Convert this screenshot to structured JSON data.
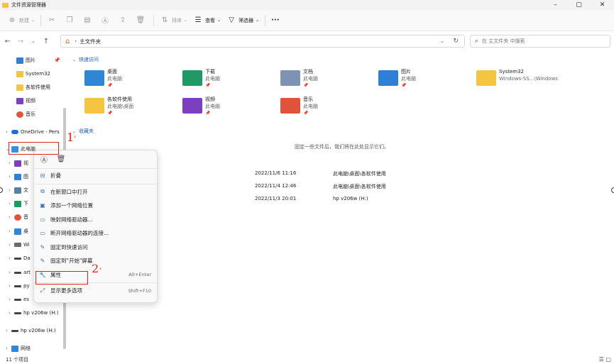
{
  "window": {
    "title": "文件资源管理器",
    "min": "–",
    "max": "▢",
    "close": "✕"
  },
  "toolbar": {
    "new_label": "新建",
    "sort_label": "排序",
    "view_label": "查看",
    "filter_label": "筛选器",
    "more_label": "···"
  },
  "address": {
    "path": "主文件夹",
    "search_placeholder": "在 主文件夹 中搜索"
  },
  "sidebar": {
    "pinned": [
      {
        "label": "图片",
        "icon": "pictures-icon"
      },
      {
        "label": "System32",
        "icon": "folder-icon"
      },
      {
        "label": "各软件使用",
        "icon": "folder-icon"
      },
      {
        "label": "视频",
        "icon": "videos-icon"
      },
      {
        "label": "音乐",
        "icon": "music-icon"
      }
    ],
    "onedrive": "OneDrive - Pers",
    "this_pc": "此电脑",
    "pc_children": [
      "视",
      "图",
      "文",
      "下",
      "音",
      "桌",
      "Wi",
      "Da",
      "art",
      "py",
      "es"
    ],
    "drive_h_1": "hp v206w (H:)",
    "drive_h_2": "hp v206w (H:)",
    "network": "网络"
  },
  "main": {
    "quick_access_label": "快速访问",
    "favorites_label": "收藏夹",
    "favorites_empty": "固定一些文件后，我们将在此处显示它们。",
    "quick_items": [
      {
        "name": "桌面",
        "sub": "此电脑",
        "pinned": "📌"
      },
      {
        "name": "下载",
        "sub": "此电脑",
        "pinned": "📌"
      },
      {
        "name": "文档",
        "sub": "此电脑",
        "pinned": "📌"
      },
      {
        "name": "图片",
        "sub": "此电脑",
        "pinned": "📌"
      },
      {
        "name": "System32",
        "sub": "Windows-SS...\\Windows",
        "pinned": ""
      },
      {
        "name": "各软件使用",
        "sub": "此电脑\\桌面",
        "pinned": "📌"
      },
      {
        "name": "视频",
        "sub": "此电脑",
        "pinned": "📌"
      },
      {
        "name": "音乐",
        "sub": "此电脑",
        "pinned": "📌"
      }
    ],
    "recent": [
      {
        "date": "2022/11/6 11:16",
        "location": "此电脑\\桌面\\各软件使用"
      },
      {
        "date": "2022/11/4 12:46",
        "location": "此电脑\\桌面\\各软件使用"
      },
      {
        "date": "2022/11/3 20:01",
        "location": "hp v206w (H:)"
      }
    ]
  },
  "context_menu": {
    "items": [
      {
        "label": "折叠",
        "shortcut": ""
      },
      {
        "label": "在新窗口中打开",
        "shortcut": ""
      },
      {
        "label": "添加一个网络位置",
        "shortcut": ""
      },
      {
        "label": "映射网络驱动器...",
        "shortcut": ""
      },
      {
        "label": "断开网络驱动器的连接...",
        "shortcut": ""
      },
      {
        "label": "固定到快速访问",
        "shortcut": ""
      },
      {
        "label": "固定到\"开始\"屏幕",
        "shortcut": ""
      },
      {
        "label": "属性",
        "shortcut": "Alt+Enter"
      },
      {
        "label": "显示更多选项",
        "shortcut": "Shift+F10"
      }
    ]
  },
  "annotations": {
    "step1": "1",
    "step2": "2"
  },
  "status": {
    "count": "11 个项目"
  },
  "colors": {
    "accent": "#1a5fb4",
    "annotation_red": "#e0221a",
    "folder_yellow": "#f5c542"
  }
}
